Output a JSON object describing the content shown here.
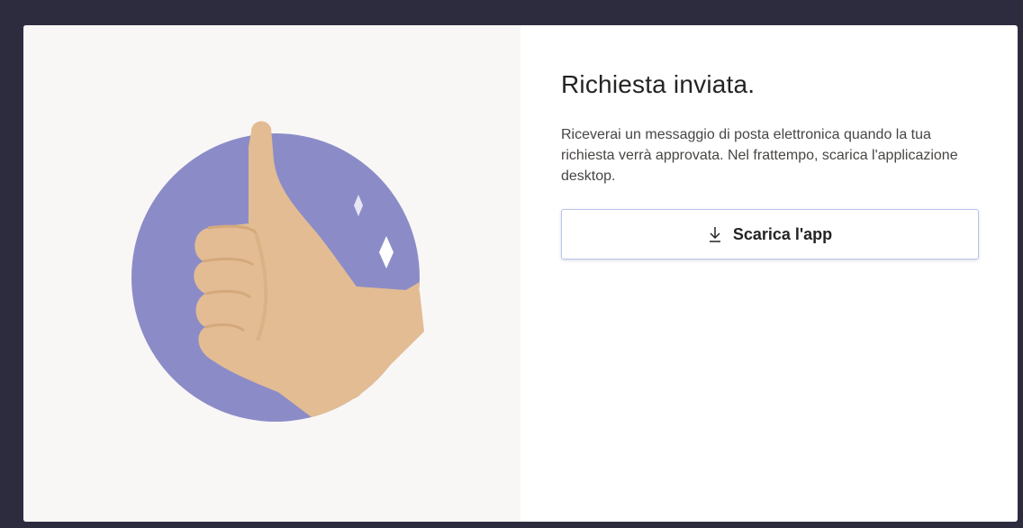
{
  "dialog": {
    "title": "Richiesta inviata.",
    "description": "Riceverai un messaggio di posta elettronica quando la tua richiesta verrà approvata. Nel frattempo, scarica l'applicazione desktop.",
    "download_button_label": "Scarica l'app",
    "download_icon": "download-icon",
    "illustration": "thumbs-up-illustration"
  },
  "colors": {
    "background": "#2d2c3f",
    "left_panel": "#f8f7f6",
    "circle": "#8b8cc7",
    "hand": "#e3bc93",
    "sparkle": "#ffffff"
  }
}
